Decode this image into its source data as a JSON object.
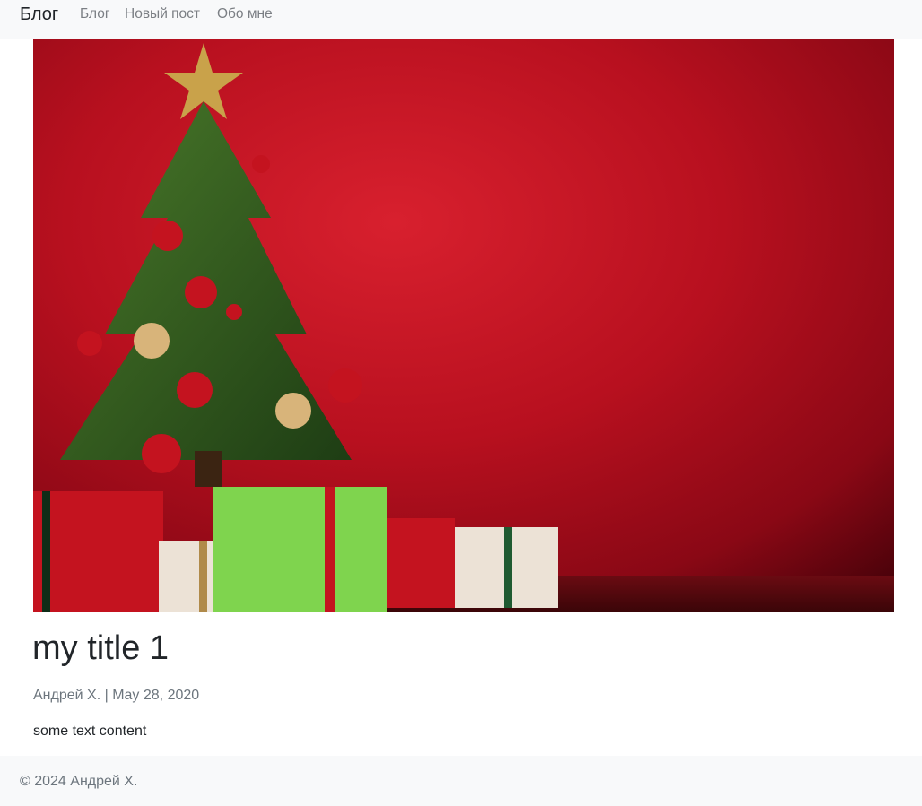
{
  "nav": {
    "brand": "Блог",
    "links": [
      "Блог",
      "Новый пост",
      "Обо мне"
    ]
  },
  "hero": {
    "icon": "christmas-tree-photo"
  },
  "post": {
    "title": "my title 1",
    "author": "Андрей Х.",
    "separator": "|",
    "date": "May 28, 2020",
    "content": "some text content"
  },
  "footer": {
    "text": "© 2024 Андрей Х."
  },
  "colors": {
    "navbar_bg": "#f8f9fa",
    "nav_link": "#7b7f84",
    "meta_text": "#6c757d",
    "hero_red": "#c8102e"
  }
}
